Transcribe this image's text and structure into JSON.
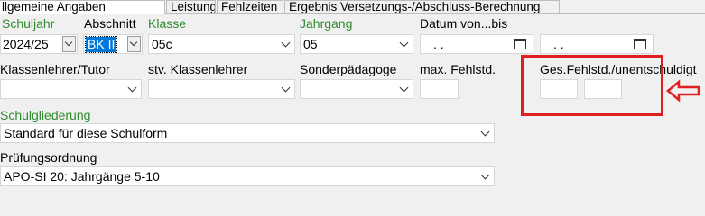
{
  "tabs": [
    {
      "label": "llgemeine Angaben",
      "active": true
    },
    {
      "label": "Leistungsdaten",
      "active": false
    },
    {
      "label": "Fehlzeiten",
      "active": false
    },
    {
      "label": "Ergebnis Versetzungs-/Abschluss-Berechnung",
      "active": false
    }
  ],
  "fields": {
    "schuljahr": {
      "label": "Schuljahr",
      "value": "2024/25"
    },
    "abschnitt": {
      "label": "Abschnitt",
      "value": "BK II"
    },
    "klasse": {
      "label": "Klasse",
      "value": "05c"
    },
    "jahrgang": {
      "label": "Jahrgang",
      "value": "05"
    },
    "datum": {
      "label": "Datum von...bis",
      "from": ".  .",
      "to": ".  ."
    },
    "klassenlehrer": {
      "label": "Klassenlehrer/Tutor",
      "value": ""
    },
    "stv_klassenlehrer": {
      "label": "stv. Klassenlehrer",
      "value": ""
    },
    "sonderpaedagoge": {
      "label": "Sonderpädagoge",
      "value": ""
    },
    "max_fehlstd": {
      "label": "max. Fehlstd.",
      "value": ""
    },
    "ges_fehlstd": {
      "label": "Ges.Fehlstd./unentschuldigt",
      "ges": "",
      "unentschuldigt": ""
    },
    "schulgliederung": {
      "label": "Schulgliederung",
      "value": "Standard für diese Schulform"
    },
    "pruefungsordnung": {
      "label": "Prüfungsordnung",
      "value": "APO-SI 20: Jahrgänge 5-10"
    }
  },
  "colors": {
    "green_label": "#2e8b2e",
    "annotation_red": "#e02020",
    "selection_blue": "#0078d7"
  },
  "icons": [
    "calendar-icon",
    "chevron-down-icon",
    "red-arrow-annotation-icon"
  ]
}
